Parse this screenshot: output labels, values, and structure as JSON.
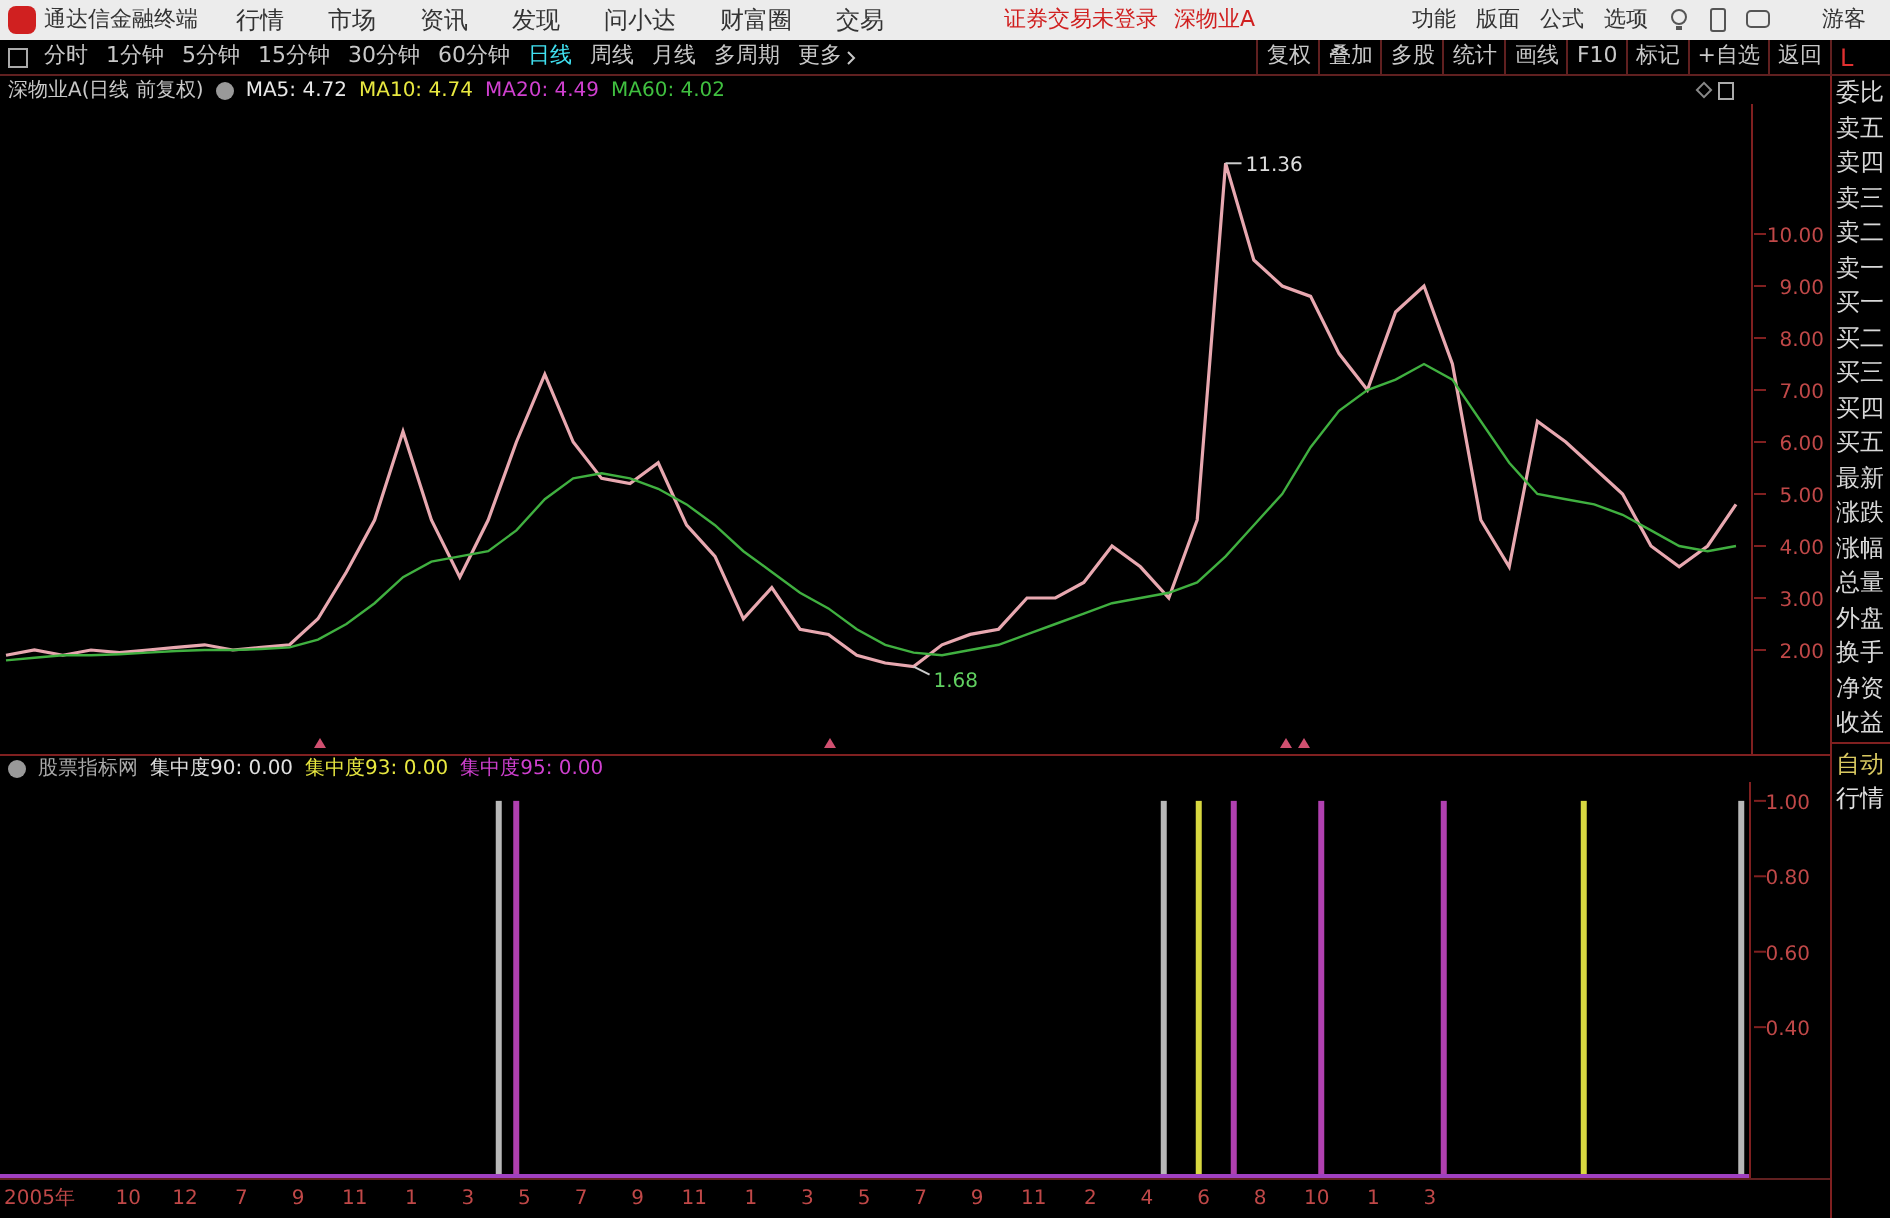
{
  "app_bar": {
    "title": "通达信金融终端",
    "menu": [
      "行情",
      "市场",
      "资讯",
      "发现",
      "问小达",
      "财富圈",
      "交易"
    ],
    "login_status": "证券交易未登录",
    "stock_name": "深物业A",
    "right_menu": [
      "功能",
      "版面",
      "公式",
      "选项"
    ],
    "user": "游客"
  },
  "toolbar": {
    "periods": [
      {
        "label": "分时",
        "selected": false
      },
      {
        "label": "1分钟",
        "selected": false
      },
      {
        "label": "5分钟",
        "selected": false
      },
      {
        "label": "15分钟",
        "selected": false
      },
      {
        "label": "30分钟",
        "selected": false
      },
      {
        "label": "60分钟",
        "selected": false
      },
      {
        "label": "日线",
        "selected": true
      },
      {
        "label": "周线",
        "selected": false
      },
      {
        "label": "月线",
        "selected": false
      },
      {
        "label": "多周期",
        "selected": false
      }
    ],
    "more": "更多",
    "buttons": [
      "复权",
      "叠加",
      "多股",
      "统计",
      "画线",
      "F10",
      "标记",
      "+自选",
      "返回"
    ],
    "corner_label": "L"
  },
  "price_panel": {
    "title": "深物业A(日线 前复权)",
    "indicators": [
      {
        "label": "MA5: 4.72",
        "color": "#e8e8e8"
      },
      {
        "label": "MA10: 4.74",
        "color": "#e8e840"
      },
      {
        "label": "MA20: 4.49",
        "color": "#d040d0"
      },
      {
        "label": "MA60: 4.02",
        "color": "#40c040"
      }
    ],
    "chart_data": {
      "type": "line",
      "categories": [
        null,
        null,
        null,
        null,
        null,
        null,
        null,
        null,
        null,
        null,
        null,
        null,
        null,
        null,
        null,
        null,
        null,
        null,
        null,
        null,
        null,
        null,
        null,
        null,
        null,
        null,
        null,
        null,
        null,
        null,
        null,
        null,
        null,
        null,
        null,
        null,
        null,
        null,
        null,
        null,
        null,
        null,
        null,
        null,
        null,
        null,
        null,
        null,
        null,
        null,
        null,
        null,
        null,
        null,
        null,
        null,
        null,
        null,
        null,
        null,
        null,
        null
      ],
      "ylim": [
        0,
        12.5
      ],
      "yticks": [
        {
          "value": 2,
          "label": "2.00"
        },
        {
          "value": 3,
          "label": "3.00"
        },
        {
          "value": 4,
          "label": "4.00"
        },
        {
          "value": 5,
          "label": "5.00"
        },
        {
          "value": 6,
          "label": "6.00"
        },
        {
          "value": 7,
          "label": "7.00"
        },
        {
          "value": 8,
          "label": "8.00"
        },
        {
          "value": 9,
          "label": "9.00"
        },
        {
          "value": 10,
          "label": "10.00"
        }
      ],
      "series": [
        {
          "color": "#e8a8b0",
          "values": [
            1.9,
            2,
            1.9,
            2,
            1.95,
            2,
            2.05,
            2.1,
            2,
            2.05,
            2.1,
            2.6,
            3.5,
            4.5,
            6.2,
            4.5,
            3.4,
            4.5,
            6,
            7.3,
            6,
            5.3,
            5.2,
            5.6,
            4.4,
            3.8,
            2.6,
            3.2,
            2.4,
            2.3,
            1.9,
            1.75,
            1.68,
            2.1,
            2.3,
            2.4,
            3,
            3,
            3.3,
            4,
            3.6,
            3,
            4.5,
            11.36,
            9.5,
            9,
            8.8,
            7.7,
            7,
            8.5,
            9,
            7.5,
            4.5,
            3.6,
            6.4,
            6,
            5.5,
            5,
            4,
            3.6,
            4,
            4.8
          ]
        },
        {
          "color": "#40b040",
          "values": [
            1.8,
            1.85,
            1.9,
            1.9,
            1.92,
            1.95,
            1.98,
            2,
            2,
            2.02,
            2.05,
            2.2,
            2.5,
            2.9,
            3.4,
            3.7,
            3.8,
            3.9,
            4.3,
            4.9,
            5.3,
            5.4,
            5.3,
            5.1,
            4.8,
            4.4,
            3.9,
            3.5,
            3.1,
            2.8,
            2.4,
            2.1,
            1.95,
            1.9,
            2,
            2.1,
            2.3,
            2.5,
            2.7,
            2.9,
            3,
            3.1,
            3.3,
            3.8,
            4.4,
            5,
            5.9,
            6.6,
            7,
            7.2,
            7.5,
            7.2,
            6.4,
            5.6,
            5,
            4.9,
            4.8,
            4.6,
            4.3,
            4,
            3.9,
            4
          ]
        }
      ],
      "annotations": [
        {
          "text": "11.36"
        },
        {
          "text": "1.68"
        }
      ]
    }
  },
  "indicator_panel": {
    "title": "股票指标网",
    "indicators": [
      {
        "label": "集中度90: 0.00",
        "color": "#e0e0e0"
      },
      {
        "label": "集中度93: 0.00",
        "color": "#e8e840"
      },
      {
        "label": "集中度95: 0.00",
        "color": "#d040d0"
      }
    ],
    "chart_data": {
      "type": "bar",
      "categories": [
        null,
        null,
        null,
        null,
        null,
        null,
        null,
        null,
        null,
        null,
        null,
        null,
        null,
        null,
        null,
        null,
        null,
        null,
        null,
        null,
        null,
        null,
        null,
        null,
        null,
        null,
        null,
        null,
        null,
        null,
        null,
        null,
        null,
        null,
        null,
        null,
        null,
        null,
        null,
        null,
        null,
        null,
        null,
        null,
        null,
        null,
        null,
        null,
        null,
        null,
        null,
        null,
        null,
        null,
        null,
        null,
        null,
        null,
        null,
        null,
        null,
        null,
        null,
        null,
        null,
        null,
        null,
        null,
        null,
        null,
        null,
        null,
        null,
        null,
        null,
        null,
        null,
        null,
        null,
        null,
        null,
        null,
        null,
        null,
        null,
        null,
        null,
        null,
        null,
        null,
        null,
        null,
        null,
        null,
        null,
        null,
        null,
        null,
        null,
        null
      ],
      "ylim": [
        0,
        1.05
      ],
      "yticks": [
        {
          "value": 0.4,
          "label": "0.40"
        },
        {
          "value": 0.6,
          "label": "0.60"
        },
        {
          "value": 0.8,
          "label": "0.80"
        },
        {
          "value": 1,
          "label": "1.00"
        }
      ],
      "series": [
        {
          "color": "#b8b8b8",
          "values": [
            null,
            null,
            null,
            null,
            null,
            null,
            null,
            null,
            null,
            null,
            null,
            null,
            null,
            null,
            null,
            null,
            null,
            null,
            null,
            null,
            null,
            null,
            null,
            null,
            null,
            null,
            null,
            null,
            1,
            null,
            null,
            null,
            null,
            null,
            null,
            null,
            null,
            null,
            null,
            null,
            null,
            null,
            null,
            null,
            null,
            null,
            null,
            null,
            null,
            null,
            null,
            null,
            null,
            null,
            null,
            null,
            null,
            null,
            null,
            null,
            null,
            null,
            null,
            null,
            null,
            null,
            1,
            null,
            null,
            null,
            null,
            null,
            null,
            null,
            null,
            null,
            null,
            null,
            null,
            null,
            null,
            null,
            null,
            null,
            null,
            null,
            null,
            null,
            null,
            null,
            null,
            null,
            null,
            null,
            null,
            null,
            null,
            null,
            null,
            1
          ]
        },
        {
          "color": "#d8d840",
          "values": [
            null,
            null,
            null,
            null,
            null,
            null,
            null,
            null,
            null,
            null,
            null,
            null,
            null,
            null,
            null,
            null,
            null,
            null,
            null,
            null,
            null,
            null,
            null,
            null,
            null,
            null,
            null,
            null,
            null,
            null,
            null,
            null,
            null,
            null,
            null,
            null,
            null,
            null,
            null,
            null,
            null,
            null,
            null,
            null,
            null,
            null,
            null,
            null,
            null,
            null,
            null,
            null,
            null,
            null,
            null,
            null,
            null,
            null,
            null,
            null,
            null,
            null,
            null,
            null,
            null,
            null,
            null,
            null,
            1,
            null,
            null,
            null,
            null,
            null,
            null,
            null,
            null,
            null,
            null,
            null,
            null,
            null,
            null,
            null,
            null,
            null,
            null,
            null,
            null,
            null,
            1,
            null,
            null,
            null,
            null,
            null,
            null,
            null,
            null,
            null
          ]
        },
        {
          "color": "#b040b0",
          "values": [
            null,
            null,
            null,
            null,
            null,
            null,
            null,
            null,
            null,
            null,
            null,
            null,
            null,
            null,
            null,
            null,
            null,
            null,
            null,
            null,
            null,
            null,
            null,
            null,
            null,
            null,
            null,
            null,
            null,
            1,
            null,
            null,
            null,
            null,
            null,
            null,
            null,
            null,
            null,
            null,
            null,
            null,
            null,
            null,
            null,
            null,
            null,
            null,
            null,
            null,
            null,
            null,
            null,
            null,
            null,
            null,
            null,
            null,
            null,
            null,
            null,
            null,
            null,
            null,
            null,
            null,
            null,
            null,
            null,
            null,
            1,
            null,
            null,
            null,
            null,
            1,
            null,
            null,
            null,
            null,
            null,
            null,
            1,
            null,
            null,
            null,
            null,
            null,
            null,
            null,
            null,
            null,
            null,
            null,
            null,
            null,
            null,
            null,
            null,
            null
          ]
        }
      ]
    }
  },
  "time_axis": [
    "2005年",
    "10",
    "12",
    "7",
    "9",
    "11",
    "1",
    "3",
    "5",
    "7",
    "9",
    "11",
    "1",
    "3",
    "5",
    "7",
    "9",
    "11",
    "2",
    "4",
    "6",
    "8",
    "10",
    "1",
    "3"
  ],
  "side_panel": {
    "items": [
      "委比",
      "卖五",
      "卖四",
      "卖三",
      "卖二",
      "卖一",
      "买一",
      "买二",
      "买三",
      "买四",
      "买五",
      "最新",
      "涨跌",
      "涨幅",
      "总量",
      "外盘",
      "换手",
      "净资",
      "收益"
    ],
    "lower_items": [
      {
        "label": "自动",
        "color": "#d8c860"
      },
      {
        "label": "行情",
        "color": "#e0e0e0"
      }
    ]
  }
}
